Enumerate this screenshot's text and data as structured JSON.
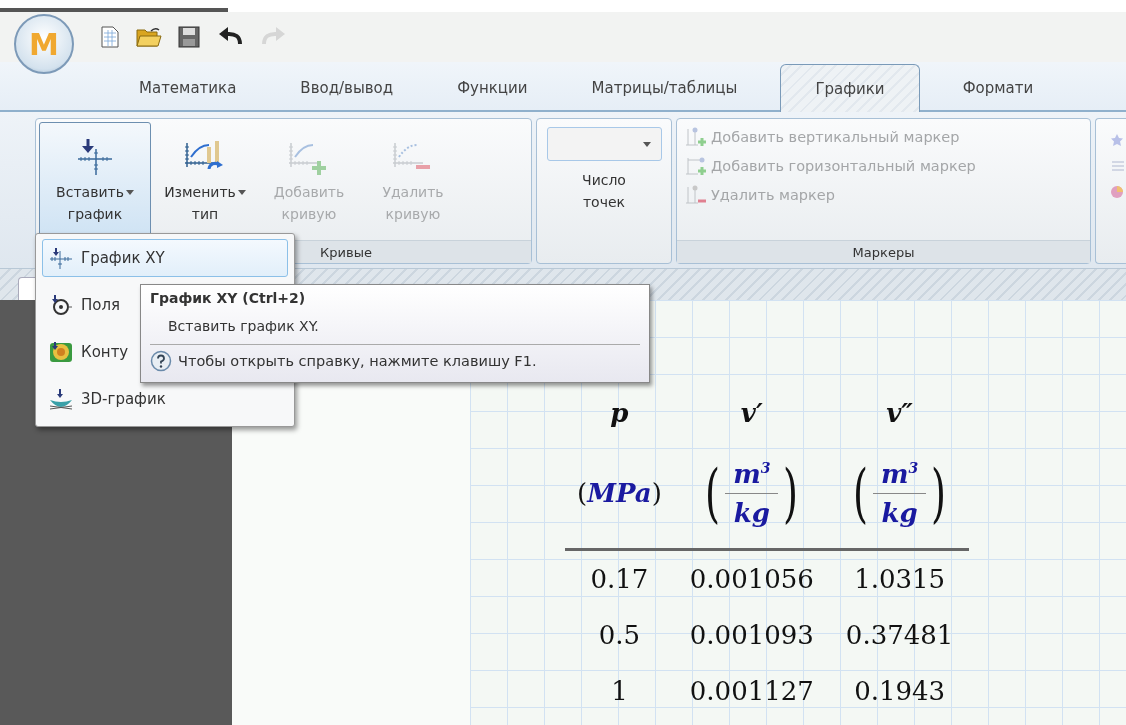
{
  "app_logo": "M",
  "quick_access": [
    {
      "kind": "new",
      "disabled": false
    },
    {
      "kind": "open",
      "disabled": false
    },
    {
      "kind": "save",
      "disabled": false
    },
    {
      "kind": "undo",
      "disabled": false
    },
    {
      "kind": "redo",
      "disabled": true
    }
  ],
  "tabs": [
    {
      "label": "Математика",
      "selected": false
    },
    {
      "label": "Ввод/вывод",
      "selected": false
    },
    {
      "label": "Функции",
      "selected": false
    },
    {
      "label": "Матрицы/таблицы",
      "selected": false
    },
    {
      "label": "Графики",
      "selected": true
    },
    {
      "label": "Формати",
      "selected": false
    }
  ],
  "ribbon": {
    "curves": {
      "label": "Кривые",
      "buttons": [
        {
          "kind": "insert",
          "lines": [
            "Вставить",
            "график"
          ],
          "dropdown": true,
          "pressed": true,
          "disabled": false
        },
        {
          "kind": "change",
          "lines": [
            "Изменить",
            "тип"
          ],
          "dropdown": true,
          "pressed": false,
          "disabled": false
        },
        {
          "kind": "add",
          "lines": [
            "Добавить",
            "кривую"
          ],
          "dropdown": false,
          "pressed": false,
          "disabled": true
        },
        {
          "kind": "remove",
          "lines": [
            "Удалить",
            "кривую"
          ],
          "dropdown": false,
          "pressed": false,
          "disabled": true
        }
      ]
    },
    "points": {
      "lines": [
        "Число",
        "точек"
      ]
    },
    "markers": {
      "label": "Маркеры",
      "items": [
        {
          "kind": "vertical",
          "label": "Добавить вертикальный маркер",
          "disabled": true
        },
        {
          "kind": "horizontal",
          "label": "Добавить горизонтальный маркер",
          "disabled": true
        },
        {
          "kind": "remove",
          "label": "Удалить маркер",
          "disabled": true
        }
      ]
    }
  },
  "menu": [
    {
      "kind": "xy",
      "label": "График XY",
      "selected": true
    },
    {
      "kind": "polar",
      "label": "Поля",
      "selected": false
    },
    {
      "kind": "contour",
      "label": "Конту",
      "selected": false
    },
    {
      "kind": "surface",
      "label": "3D-график",
      "selected": false
    }
  ],
  "tooltip": {
    "title": "График XY (Ctrl+2)",
    "description": "Вставить график XY.",
    "help": "Чтобы открыть справку, нажмите клавишу F1."
  },
  "table": {
    "columns": [
      {
        "name": "p",
        "unit": {
          "kind": "inline",
          "open": "(",
          "text": "MPa",
          "close": ")"
        }
      },
      {
        "name": "v′",
        "unit": {
          "kind": "fraction",
          "open": "(",
          "numerator": "m$^{3}$",
          "denominator": "kg",
          "close": ")"
        }
      },
      {
        "name": "v″",
        "unit": {
          "kind": "fraction",
          "open": "(",
          "numerator": "m$^{3}$",
          "denominator": "kg",
          "close": ")"
        }
      }
    ],
    "rows": [
      [
        "0.17",
        "0.001056",
        "1.0315"
      ],
      [
        "0.5",
        "0.001093",
        "0.37481"
      ],
      [
        "1",
        "0.001127",
        "0.1943"
      ]
    ]
  }
}
